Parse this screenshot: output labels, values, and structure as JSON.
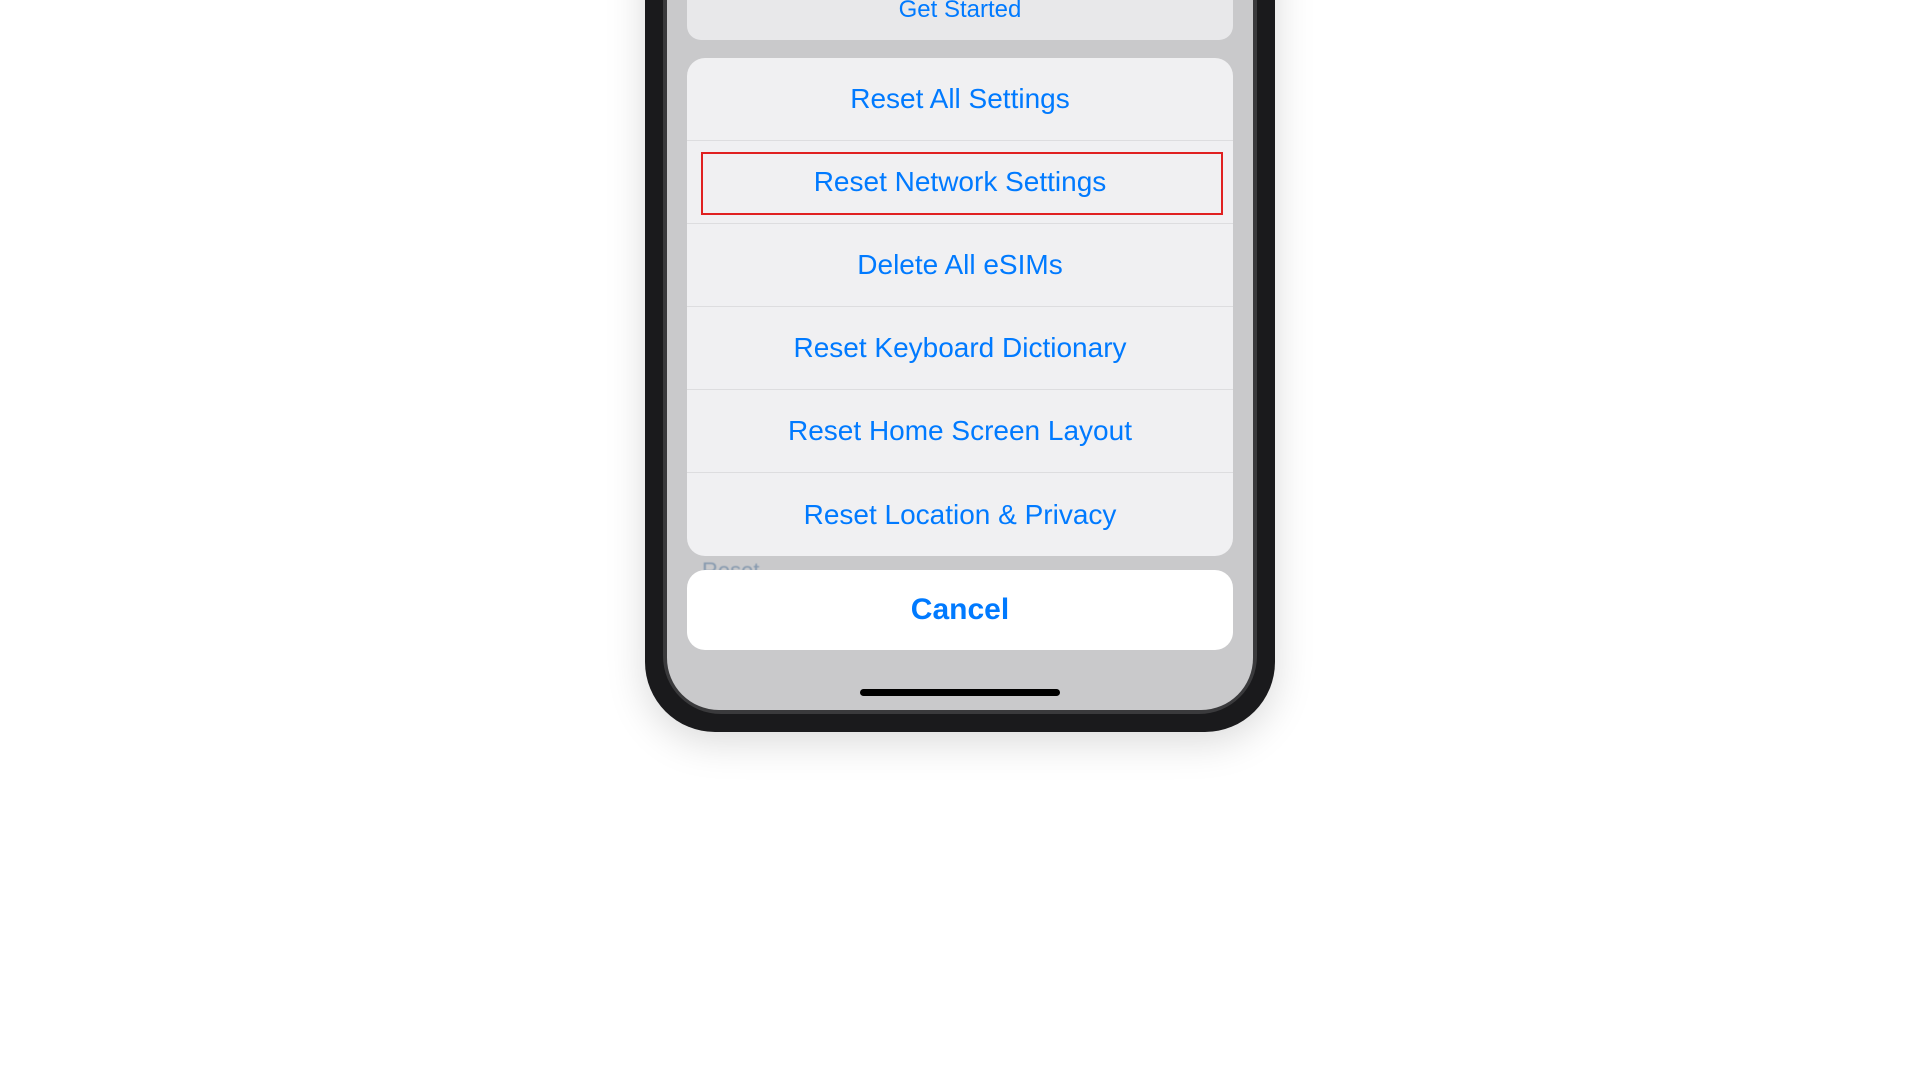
{
  "background": {
    "get_started_label": "Get Started",
    "reset_hint": "Reset"
  },
  "action_sheet": {
    "options": [
      {
        "label": "Reset All Settings",
        "highlighted": false
      },
      {
        "label": "Reset Network Settings",
        "highlighted": true
      },
      {
        "label": "Delete All eSIMs",
        "highlighted": false
      },
      {
        "label": "Reset Keyboard Dictionary",
        "highlighted": false
      },
      {
        "label": "Reset Home Screen Layout",
        "highlighted": false
      },
      {
        "label": "Reset Location & Privacy",
        "highlighted": false
      }
    ],
    "cancel_label": "Cancel"
  },
  "colors": {
    "ios_blue": "#007aff",
    "highlight_red": "#e02020"
  }
}
